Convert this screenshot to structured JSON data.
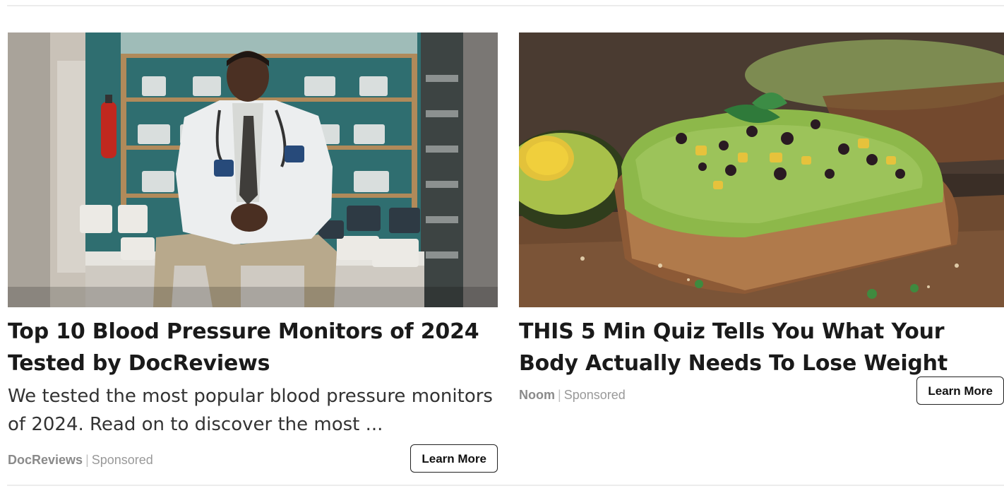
{
  "ads": [
    {
      "headline": "Top 10 Blood Pressure Monitors of 2024 Tested by DocReviews",
      "description": "We tested the most popular blood pressure monitors of 2024. Read on to discover the most ...",
      "brand": "DocReviews",
      "separator": "|",
      "sponsored": "Sponsored",
      "cta": "Learn More"
    },
    {
      "headline": "THIS 5 Min Quiz Tells You What Your Body Actually Needs To Lose Weight",
      "description": "",
      "brand": "Noom",
      "separator": "|",
      "sponsored": "Sponsored",
      "cta": "Learn More"
    }
  ],
  "colors": {
    "headline": "#1a1a1a",
    "meta": "#999999",
    "button_border": "#222222",
    "divider": "#ececec"
  }
}
